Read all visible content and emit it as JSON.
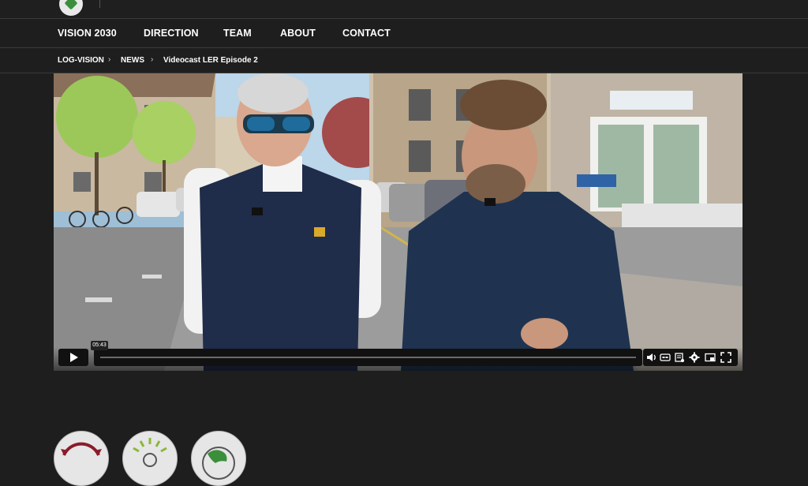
{
  "header": {
    "tagline": "",
    "logo_icon": "log-vision-logo-icon"
  },
  "nav": {
    "items": [
      {
        "label": "VISION 2030"
      },
      {
        "label": "DIRECTION"
      },
      {
        "label": "TEAM"
      },
      {
        "label": "ABOUT"
      },
      {
        "label": "CONTACT"
      }
    ]
  },
  "breadcrumb": {
    "items": [
      {
        "label": "LOG-VISION"
      },
      {
        "label": "NEWS"
      },
      {
        "label": "Videocast LER Episode 2"
      }
    ],
    "separator": "›"
  },
  "video": {
    "time_tooltip": "05:43",
    "progress": 0.0,
    "icons": [
      "play-icon",
      "volume-icon",
      "captions-icon",
      "transcript-icon",
      "settings-icon",
      "pip-icon",
      "fullscreen-icon"
    ]
  },
  "bottom_icons": [
    "cycle-icon",
    "sunburst-icon",
    "globe-icon"
  ],
  "colors": {
    "background": "#1e1e1e",
    "text": "#ffffff",
    "accent_red": "#8a1c2b",
    "accent_green": "#3b8f3b"
  }
}
